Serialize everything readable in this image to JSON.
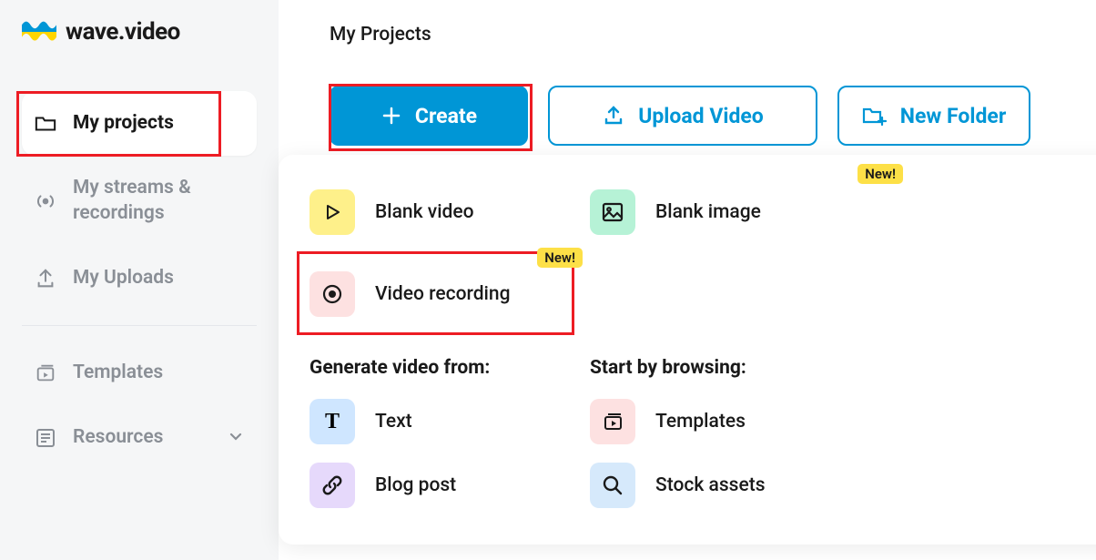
{
  "brand": {
    "name": "wave.video"
  },
  "sidebar": {
    "items": [
      {
        "label": "My projects"
      },
      {
        "label": "My streams & recordings"
      },
      {
        "label": "My Uploads"
      },
      {
        "label": "Templates"
      },
      {
        "label": "Resources"
      }
    ]
  },
  "page": {
    "title": "My Projects"
  },
  "actions": {
    "create": "Create",
    "upload": "Upload Video",
    "folder": "New Folder"
  },
  "dropdown": {
    "top": [
      {
        "label": "Blank video",
        "badge": null
      },
      {
        "label": "Blank image",
        "badge": "New!"
      },
      {
        "label": "Video recording",
        "badge": "New!"
      }
    ],
    "generate_title": "Generate video from:",
    "browse_title": "Start by browsing:",
    "generate": [
      {
        "label": "Text"
      },
      {
        "label": "Blog post"
      }
    ],
    "browse": [
      {
        "label": "Templates"
      },
      {
        "label": "Stock assets"
      }
    ]
  }
}
